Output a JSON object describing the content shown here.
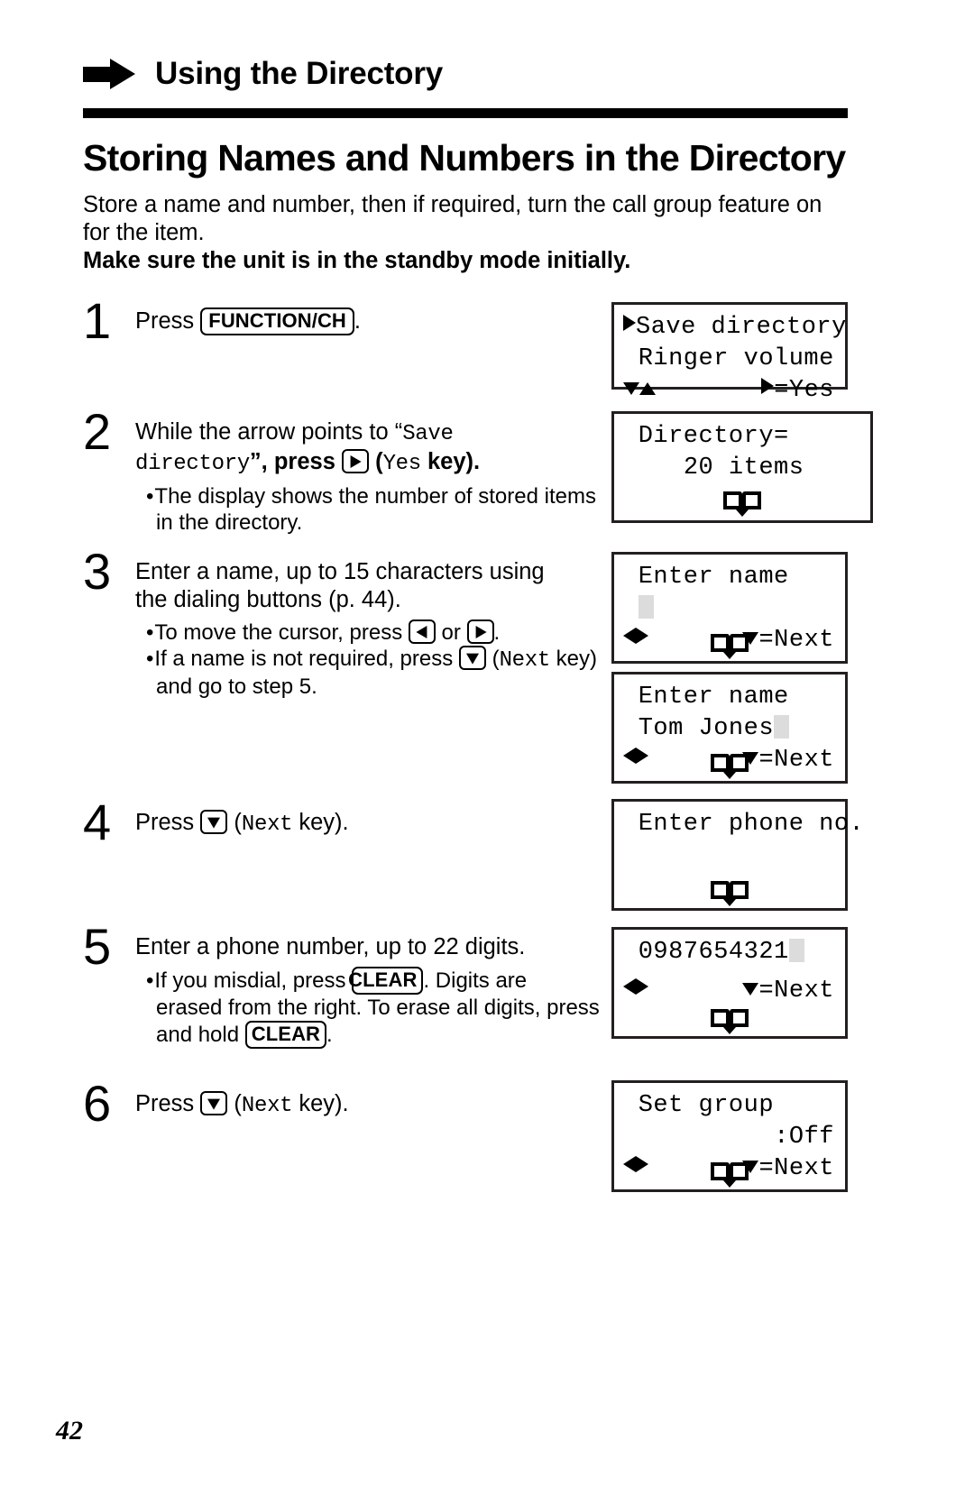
{
  "header": {
    "arrow_icon": "right-arrow-icon",
    "title": "Using the Directory"
  },
  "section": {
    "title": "Storing Names and Numbers in the Directory",
    "intro_line1": "Store a name and number, then if required, turn the call group feature on",
    "intro_line2": "for the item.",
    "intro_bold": "Make sure the unit is in the standby mode initially."
  },
  "steps": [
    {
      "number": "1",
      "text_before": "Press ",
      "key": "FUNCTION/CH",
      "text_after": "."
    },
    {
      "number": "2",
      "line1_a": "While the arrow points to “",
      "line1_mono": "Save",
      "line2_mono": "directory",
      "line2_a": "”, press ",
      "line2_key": "right-arrow-key",
      "line2_b": " (",
      "line2_mono2": "Yes",
      "line2_c": " key).",
      "bullet1_a": "The display shows the number of stored items",
      "bullet1_b": "in the directory."
    },
    {
      "number": "3",
      "line1": "Enter a name, up to 15 characters using",
      "line2": "the dialing buttons (p. 44).",
      "bullet1_a": "To move the cursor, press ",
      "bullet1_key1": "left-arrow-key",
      "bullet1_b": " or ",
      "bullet1_key2": "right-arrow-key",
      "bullet1_c": ".",
      "bullet2_a": "If a name is not required, press ",
      "bullet2_key": "down-arrow-key",
      "bullet2_b": " (",
      "bullet2_mono": "Next",
      "bullet2_c": " key)",
      "bullet2_d": "and go to step 5."
    },
    {
      "number": "4",
      "text_before": "Press ",
      "key": "down-arrow-key",
      "text_mid": " (",
      "mono": "Next",
      "text_after": " key)."
    },
    {
      "number": "5",
      "line1": "Enter a phone number, up to 22 digits.",
      "bullet1_a": "If you misdial, press ",
      "bullet1_key": "CLEAR",
      "bullet1_b": ". Digits are",
      "bullet1_c": "erased from the right. To erase all digits, press",
      "bullet1_d": "and hold ",
      "bullet1_key2": "CLEAR",
      "bullet1_e": "."
    },
    {
      "number": "6",
      "text_before": "Press ",
      "key": "down-arrow-key",
      "text_mid": " (",
      "mono": "Next",
      "text_after": " key)."
    }
  ],
  "lcds": [
    {
      "id": "lcd-save-directory",
      "line1": "Save directory",
      "line2": "Ringer volume",
      "line3_right": "=Yes"
    },
    {
      "id": "lcd-directory-count",
      "line1": "Directory=",
      "line2": "20 items"
    },
    {
      "id": "lcd-enter-name-empty",
      "line1": "Enter name",
      "line3_right": "=Next"
    },
    {
      "id": "lcd-enter-name-tom-jones",
      "line1": "Enter name",
      "line2": "Tom Jones",
      "line3_right": "=Next"
    },
    {
      "id": "lcd-enter-phone-no",
      "line1": "Enter phone no."
    },
    {
      "id": "lcd-phone-number-entered",
      "line1": "0987654321",
      "line3_right": "=Next"
    },
    {
      "id": "lcd-set-group",
      "line1": "Set group",
      "line2_right": ":Off",
      "line3_right": "=Next"
    }
  ],
  "footer": {
    "page_number": "42"
  },
  "colors": {
    "ink": "#000000",
    "lcd_border": "#231f20",
    "cursor": "#dcdcdc",
    "background": "#ffffff"
  }
}
